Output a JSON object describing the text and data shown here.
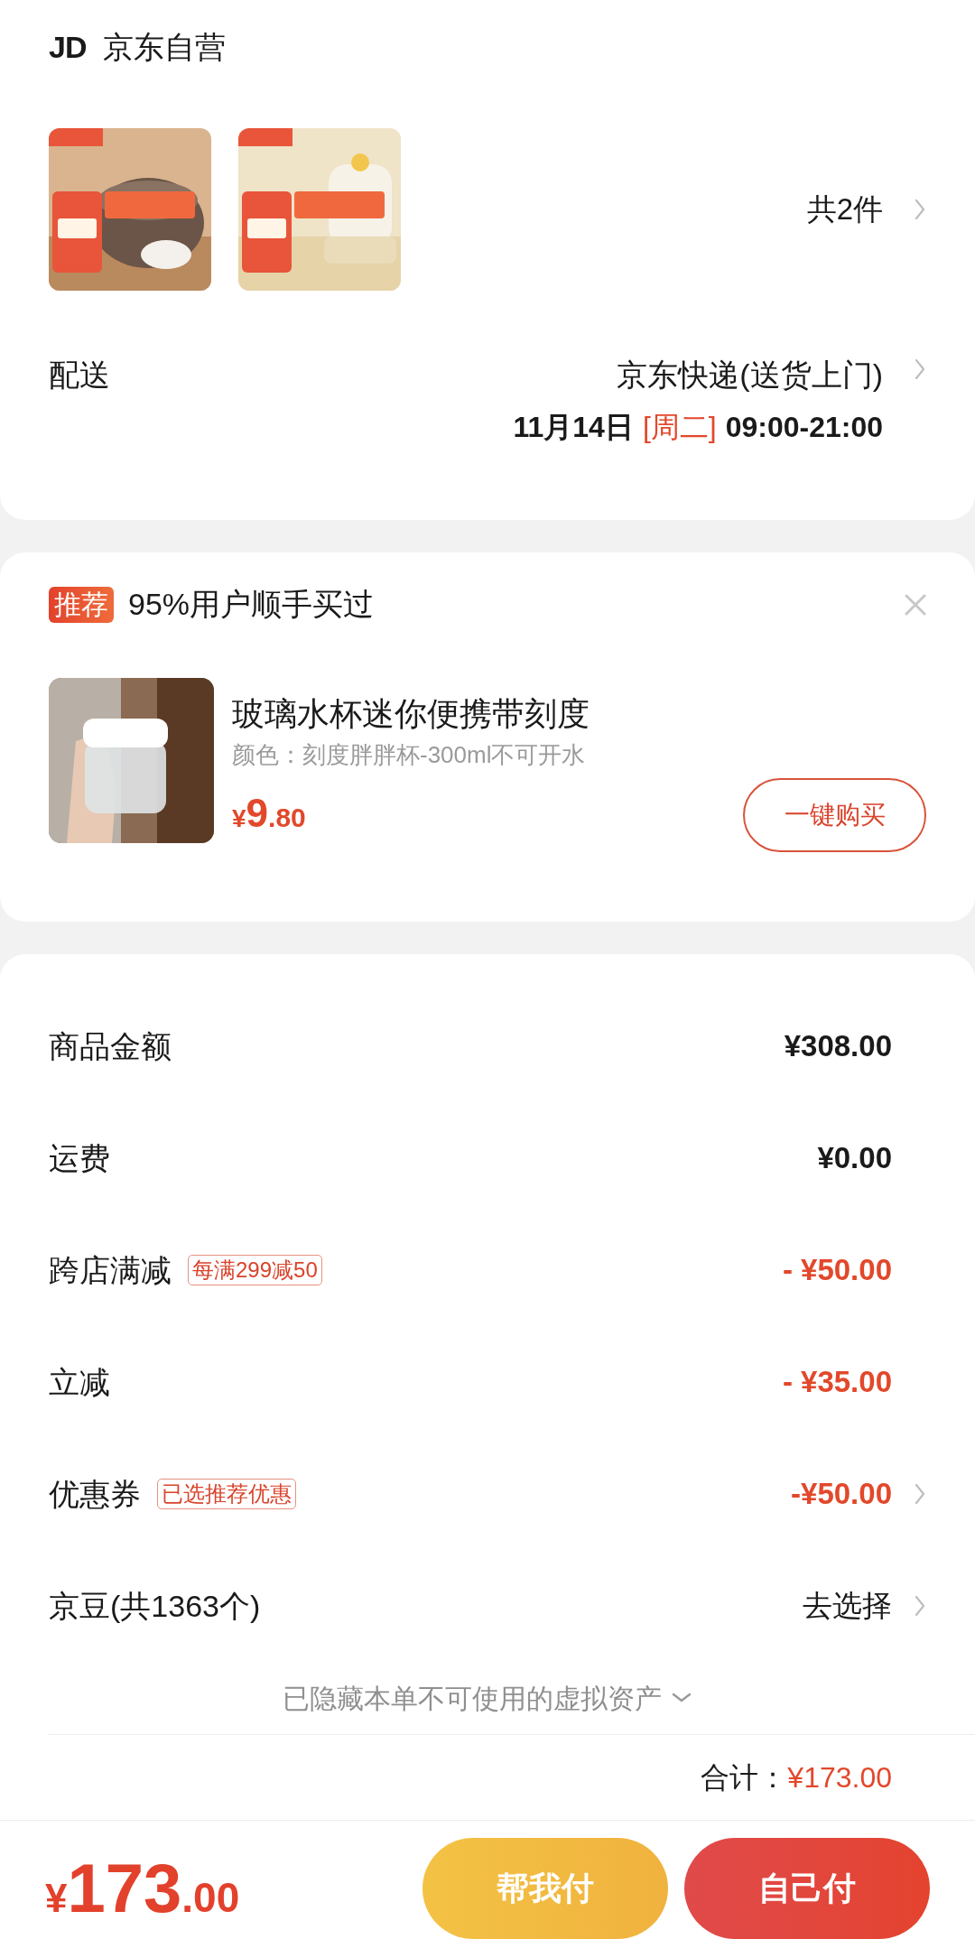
{
  "shop": {
    "logo": "JD",
    "name": "京东自营"
  },
  "products": {
    "count": "共2件"
  },
  "delivery": {
    "label": "配送",
    "method": "京东快递(送货上门)",
    "date": "11月14日",
    "weekday": "[周二]",
    "time": "09:00-21:00"
  },
  "recommend": {
    "badge": "推荐",
    "title": "95%用户顺手买过",
    "product": {
      "name": "玻璃水杯迷你便携带刻度",
      "spec": "颜色：刻度胖胖杯-300ml不可开水",
      "price_symbol": "¥",
      "price_int": "9",
      "price_dec": ".80"
    },
    "button": "一键购买"
  },
  "fees": [
    {
      "label": "商品金额",
      "value": "¥308.00",
      "accent": false,
      "chevron": false
    },
    {
      "label": "运费",
      "value": "¥0.00",
      "accent": false,
      "chevron": false
    },
    {
      "label": "跨店满减",
      "tag": "每满299减50",
      "value": "- ¥50.00",
      "accent": true,
      "chevron": false
    },
    {
      "label": "立减",
      "value": "- ¥35.00",
      "accent": true,
      "chevron": false
    },
    {
      "label": "优惠券",
      "tag": "已选推荐优惠",
      "value": "-¥50.00",
      "accent": true,
      "chevron": true
    },
    {
      "label": "京豆(共1363个)",
      "value": "去选择",
      "accent": false,
      "chevron": true
    }
  ],
  "hidden_assets": {
    "text": "已隐藏本单不可使用的虚拟资产",
    "expanded": false
  },
  "subtotal": {
    "label": "合计：",
    "value": "¥173.00"
  },
  "footer": {
    "symbol": "¥",
    "int": "173",
    "dec": ".00",
    "buttons": [
      {
        "label": "帮我付",
        "kind": "secondary"
      },
      {
        "label": "自己付",
        "kind": "primary"
      }
    ]
  }
}
